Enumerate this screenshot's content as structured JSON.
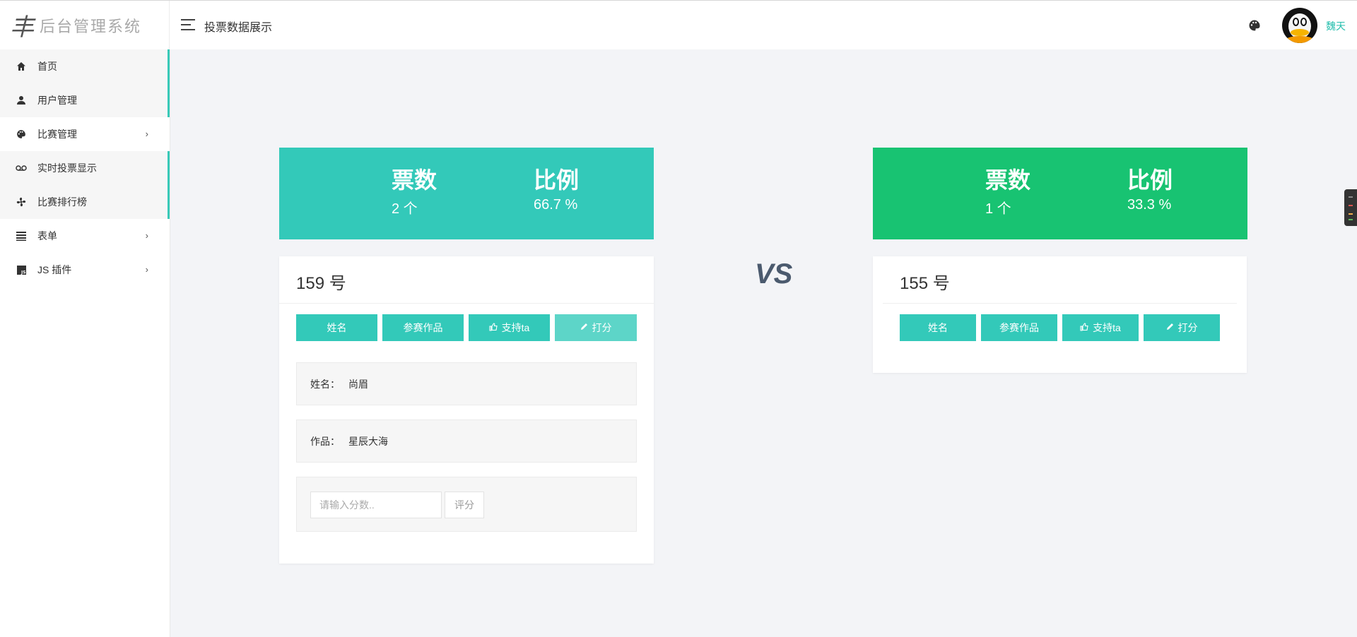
{
  "brand": {
    "logo_mark": "丰",
    "logo_text": "后台管理系统"
  },
  "header": {
    "title": "投票数据展示",
    "username": "魏天"
  },
  "sidebar": {
    "items": [
      {
        "label": "首页",
        "icon": "home-icon"
      },
      {
        "label": "用户管理",
        "icon": "user-icon"
      },
      {
        "label": "比赛管理",
        "icon": "palette-icon",
        "chevron": "›"
      },
      {
        "label": "实时投票显示",
        "icon": "voicemail-icon"
      },
      {
        "label": "比赛排行榜",
        "icon": "fan-icon"
      },
      {
        "label": "表单",
        "icon": "list-icon",
        "chevron": "›"
      },
      {
        "label": "JS 插件",
        "icon": "js-icon",
        "chevron": "›"
      }
    ]
  },
  "left": {
    "stats": {
      "votes_label": "票数",
      "votes_value": "2 个",
      "ratio_label": "比例",
      "ratio_value": "66.7 %"
    },
    "number": "159 号",
    "buttons": {
      "name": "姓名",
      "works": "参赛作品",
      "support": "支持ta",
      "score": "打分"
    },
    "name_key": "姓名：",
    "name_value": "尚眉",
    "work_key": "作品：",
    "work_value": "星辰大海",
    "score_placeholder": "请输入分数..",
    "score_submit": "评分"
  },
  "vs": "VS",
  "right": {
    "stats": {
      "votes_label": "票数",
      "votes_value": "1 个",
      "ratio_label": "比例",
      "ratio_value": "33.3 %"
    },
    "number": "155 号",
    "buttons": {
      "name": "姓名",
      "works": "参赛作品",
      "support": "支持ta",
      "score": "打分"
    }
  },
  "colors": {
    "teal": "#33c9b9",
    "green": "#18c372",
    "accent": "#26bfae"
  }
}
